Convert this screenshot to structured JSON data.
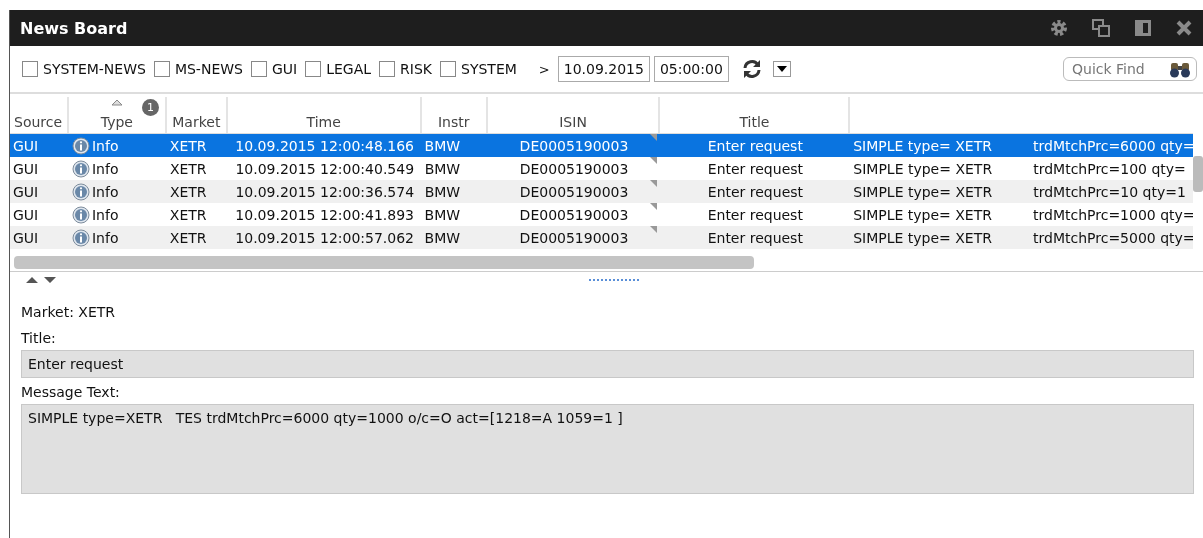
{
  "window": {
    "title": "News Board"
  },
  "filters": [
    {
      "label": "SYSTEM-NEWS",
      "checked": false
    },
    {
      "label": "MS-NEWS",
      "checked": false
    },
    {
      "label": "GUI",
      "checked": false
    },
    {
      "label": "LEGAL",
      "checked": false
    },
    {
      "label": "RISK",
      "checked": false
    },
    {
      "label": "SYSTEM",
      "checked": false
    }
  ],
  "since": {
    "operator": ">",
    "date": "10.09.2015",
    "time": "05:00:00"
  },
  "quick_find": {
    "placeholder": "Quick Find"
  },
  "table": {
    "columns": [
      {
        "label": "Source"
      },
      {
        "label": "Type",
        "sorted": true,
        "badge": "1"
      },
      {
        "label": "Market"
      },
      {
        "label": "Time"
      },
      {
        "label": "Instr"
      },
      {
        "label": "ISIN"
      },
      {
        "label": "Title"
      },
      {},
      {}
    ],
    "rows": [
      {
        "selected": true,
        "cells": [
          "GUI",
          "Info",
          "XETR",
          "10.09.2015 12:00:48.166",
          "BMW",
          "DE0005190003",
          "Enter request",
          "SIMPLE type= XETR",
          "trdMtchPrc=6000 qty="
        ]
      },
      {
        "selected": false,
        "cells": [
          "GUI",
          "Info",
          "XETR",
          "10.09.2015 12:00:40.549",
          "BMW",
          "DE0005190003",
          "Enter request",
          "SIMPLE type= XETR",
          "trdMtchPrc=100 qty="
        ]
      },
      {
        "selected": false,
        "cells": [
          "GUI",
          "Info",
          "XETR",
          "10.09.2015 12:00:36.574",
          "BMW",
          "DE0005190003",
          "Enter request",
          "SIMPLE type= XETR",
          "trdMtchPrc=10 qty=1"
        ]
      },
      {
        "selected": false,
        "cells": [
          "GUI",
          "Info",
          "XETR",
          "10.09.2015 12:00:41.893",
          "BMW",
          "DE0005190003",
          "Enter request",
          "SIMPLE type= XETR",
          "trdMtchPrc=1000 qty="
        ]
      },
      {
        "selected": false,
        "cells": [
          "GUI",
          "Info",
          "XETR",
          "10.09.2015 12:00:57.062",
          "BMW",
          "DE0005190003",
          "Enter request",
          "SIMPLE type= XETR",
          "trdMtchPrc=5000 qty="
        ]
      }
    ]
  },
  "details": {
    "market": "Market: XETR",
    "title_label": "Title:",
    "title_value": "Enter request",
    "message_label": "Message Text:",
    "message_value": "SIMPLE type=XETR   TES trdMtchPrc=6000 qty=1000 o/c=O act=[1218=A 1059=1 ]"
  }
}
